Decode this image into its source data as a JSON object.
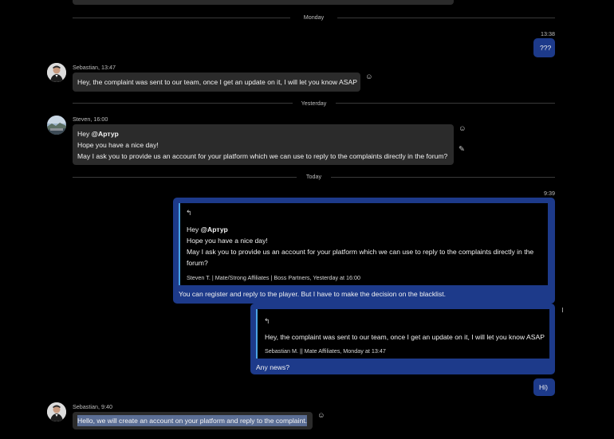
{
  "dividers": {
    "monday": "Monday",
    "yesterday": "Yesterday",
    "today": "Today"
  },
  "messages": {
    "m1": {
      "time": "13:38",
      "text": "???"
    },
    "m2": {
      "meta": "Sebastian, 13:47",
      "text": "Hey, the complaint was sent to our team, once I get an update on it, I will let you know ASAP"
    },
    "m3": {
      "meta": "Steven, 16:00",
      "greeting": "Hey ",
      "mention": "@Артур",
      "line2": "Hope you have a nice day!",
      "line3": "May I ask you to provide us an account for your platform which we can use to reply to the complaints directly in the forum?"
    },
    "m4": {
      "time": "9:39",
      "quote_greeting": "Hey ",
      "quote_mention": "@Артур",
      "quote_line2": "Hope you have a nice day!",
      "quote_line3a": "May I ask you to provide us an account for your platform which we can use to reply to the complaints directly in the",
      "quote_line3b": "forum?",
      "quote_sig": "Steven T. | Mate/Strong Affiliates | Boss Partners, Yesterday at 16:00",
      "text": "You can register and reply to the player. But I have to make the decision on the blacklist."
    },
    "m5": {
      "quote_text": "Hey, the complaint was sent to our team, once I get an update on it, I will let you know ASAP",
      "quote_sig": "Sebastian M. || Mate Affiliates, Monday at 13:47",
      "text": "Any news?"
    },
    "m6": {
      "text": "Hi)"
    },
    "m7": {
      "meta": "Sebastian, 9:40",
      "text": "Hello, we will create an account on your platform and reply to the complaint."
    }
  },
  "icons": {
    "emoji": "☺",
    "edit": "✎",
    "reply": "↰"
  },
  "colors": {
    "background": "#000000",
    "incoming_bubble": "#2b2b2b",
    "outgoing_bubble": "#1d3a8a",
    "quote_accent": "#4aa3e6",
    "selection": "#5b6e95"
  }
}
